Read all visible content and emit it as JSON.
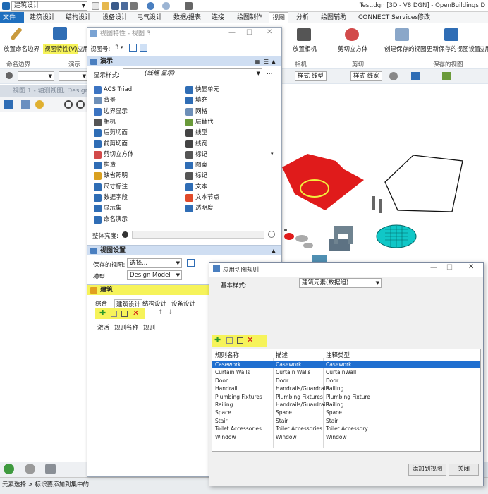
{
  "app": {
    "workspace": "建筑设计",
    "title": "Test.dgn [3D - V8 DGN] - OpenBuildings D"
  },
  "tabs": [
    "文件",
    "建筑设计",
    "结构设计",
    "设备设计",
    "电气设计",
    "数据/报表",
    "连接",
    "绘图制作",
    "视图",
    "分析",
    "绘图辅助",
    "CONNECT Services",
    "修改"
  ],
  "ribbon": {
    "buttons": [
      "放置命名边界",
      "视图特性(V)",
      "应用",
      "放置相机",
      "剪切立方体",
      "创建保存的视图",
      "更新保存的视图设置",
      "应用"
    ],
    "groups": [
      "命名边界",
      "演示",
      "相机",
      "剪切",
      "保存的视图"
    ]
  },
  "toolbar": {
    "linestyle": "样式 线型",
    "lineweight": "样式 线宽"
  },
  "view": {
    "title": "视图 1 - 轴测视图, Design M"
  },
  "status": {
    "text": "元素选择 > 标识要添加到集中的"
  },
  "view_props": {
    "title": "视图特性 - 视图 3",
    "view_number_label": "视图号:",
    "view_number": "3",
    "section_present": "演示",
    "display_style_label": "显示样式:",
    "display_style_value": "(线框 显示)",
    "items_left": [
      "ACS Triad",
      "背景",
      "边界显示",
      "相机",
      "后剪切面",
      "前剪切面",
      "剪切立方体",
      "构造",
      "缺省照明",
      "尺寸标注",
      "数据字段",
      "显示集",
      "命名演示"
    ],
    "items_right": [
      "快显单元",
      "填充",
      "网格",
      "层替代",
      "线型",
      "线宽",
      "标记",
      "图案",
      "标记",
      "文本",
      "文本节点",
      "透明度"
    ],
    "brightness_label": "整体亮度:",
    "section_view": "视图设置",
    "saved_view_label": "保存的视图:",
    "saved_view_value": "选择...",
    "model_label": "模型:",
    "model_value": "Design Model",
    "section_arch": "建筑",
    "inner_tabs": [
      "综合",
      "建筑设计",
      "结构设计",
      "设备设计"
    ],
    "columns": [
      "激活",
      "规则名称",
      "规则"
    ]
  },
  "dialog": {
    "title": "应用切图规则",
    "base_style_label": "基本样式:",
    "base_style_value": "建筑元素(数据组)",
    "columns": [
      "规则名称",
      "描述",
      "注释类型"
    ],
    "rows": [
      [
        "Casework",
        "Casework",
        "Casework"
      ],
      [
        "Curtain Walls",
        "Curtain Walls",
        "CurtainWall"
      ],
      [
        "Door",
        "Door",
        "Door"
      ],
      [
        "Handrail",
        "Handrails/Guardrails",
        "Railing"
      ],
      [
        "Plumbing Fixtures",
        "Plumbing Fixtures",
        "Plumbing Fixture"
      ],
      [
        "Railing",
        "Handrails/Guardrails",
        "Railing"
      ],
      [
        "Space",
        "Space",
        "Space"
      ],
      [
        "Stair",
        "Stair",
        "Stair"
      ],
      [
        "Toilet Accessories",
        "Toilet Accessories",
        "Toilet Accessory"
      ],
      [
        "Window",
        "Window",
        "Window"
      ]
    ],
    "add_button": "添加到视图",
    "close_button": "关闭"
  }
}
